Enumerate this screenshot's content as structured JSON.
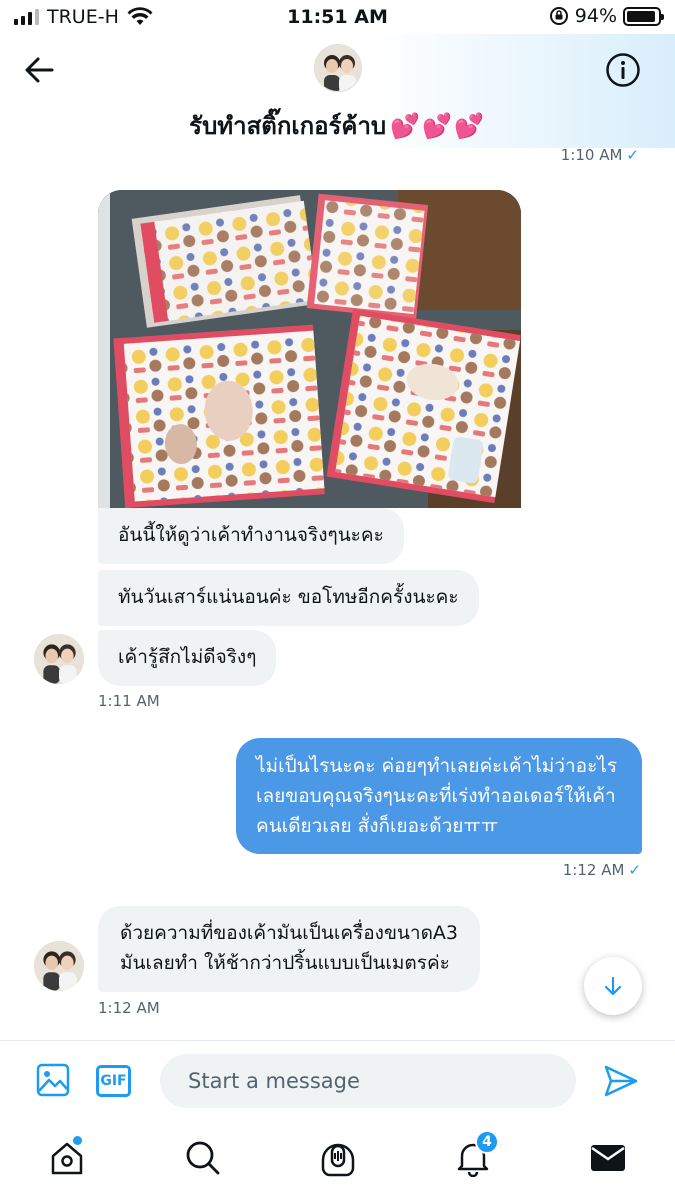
{
  "status_bar": {
    "carrier": "TRUE-H",
    "time": "11:51 AM",
    "battery": "94%",
    "battery_level": 0.94,
    "signal_bars": 3
  },
  "header": {
    "title": "รับทำสติ๊กเกอร์ค้าบ",
    "title_emoji": "💕💕💕",
    "back_icon": "arrow-left-icon",
    "info_icon": "info-icon"
  },
  "conversation": {
    "cut_timestamp": "1:10 AM",
    "incoming_group_1": {
      "messages": [
        "อันนี้ให้ดูว่าเค้าทำงานจริงๆนะคะ",
        "ทันวันเสาร์แน่นอนค่ะ ขอโทษอีกครั้งนะคะ",
        "เค้ารู้สึกไม่ดีจริงๆ"
      ],
      "timestamp": "1:11 AM"
    },
    "outgoing": {
      "text": "ไม่เป็นไรนะคะ ค่อยๆทำเลยค่ะเค้าไม่ว่าอะไรเลยขอบคุณจริงๆนะคะที่เร่งทำออเดอร์ให้เค้าคนเดียวเลย สั่งก็เยอะด้วยㅠㅠ",
      "timestamp": "1:12 AM",
      "check": "✓"
    },
    "incoming_group_2": {
      "lines": [
        "ด้วยความที่ของเค้ามันเป็นเครื่องขนาดA3",
        "มันเลยทำ ให้ช้ากว่าปริ้นแบบเป็นเมตรค่ะ"
      ],
      "timestamp": "1:12 AM"
    }
  },
  "composer": {
    "placeholder": "Start a message",
    "value": "",
    "gif_label": "GIF"
  },
  "nav": {
    "notification_count": "4"
  },
  "colors": {
    "accent": "#1d9bf0",
    "outgoing_bubble": "#4a98e6",
    "incoming_bubble": "#eff3f4",
    "header_gradient_end": "#d8eefb"
  }
}
